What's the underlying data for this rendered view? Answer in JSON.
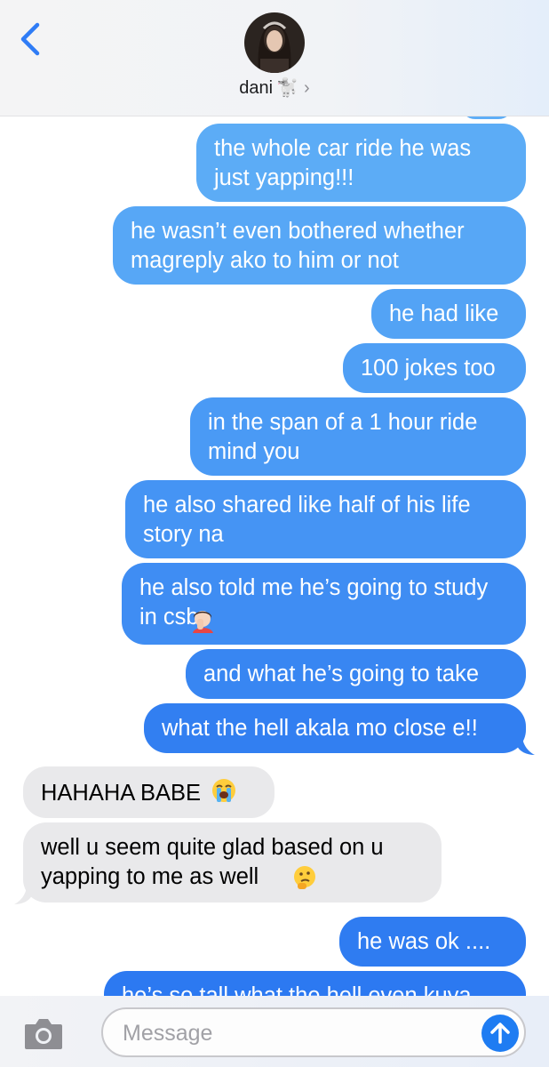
{
  "header": {
    "back_icon": "chevron-left-icon",
    "contact_name": "dani",
    "contact_emoji": "🐩",
    "details_chevron": "›"
  },
  "messages": [
    {
      "from": "me",
      "text": "the whole car ride he was just yapping!!!"
    },
    {
      "from": "me",
      "text": "he wasn’t even bothered whether magreply ako to him or not"
    },
    {
      "from": "me",
      "text": "he had like"
    },
    {
      "from": "me",
      "text": "100 jokes too"
    },
    {
      "from": "me",
      "text": "in the span of a 1 hour ride mind you"
    },
    {
      "from": "me",
      "text": "he also shared like half of his life story na"
    },
    {
      "from": "me",
      "text": "he also told me he’s going to study in csb",
      "emoji": "🤦‍♀️"
    },
    {
      "from": "me",
      "text": "and what he’s going to take"
    },
    {
      "from": "me",
      "text": "what the hell akala mo close e!!"
    },
    {
      "from": "them",
      "text": "HAHAHA BABE",
      "emoji": "😭"
    },
    {
      "from": "them",
      "text": "well u seem quite glad based on u yapping to me as well",
      "emoji": "🤔"
    },
    {
      "from": "me",
      "text": "he was ok ...."
    },
    {
      "from": "me",
      "text": "he’s so tall what the hell even kuya"
    }
  ],
  "composer": {
    "camera_icon": "camera-icon",
    "placeholder": "Message",
    "send_icon": "arrow-up-icon"
  },
  "colors": {
    "outgoing_top": "#5aaaf6",
    "outgoing_bottom": "#1c6ff0",
    "incoming": "#e9e9eb",
    "accent": "#1e7cf2"
  }
}
